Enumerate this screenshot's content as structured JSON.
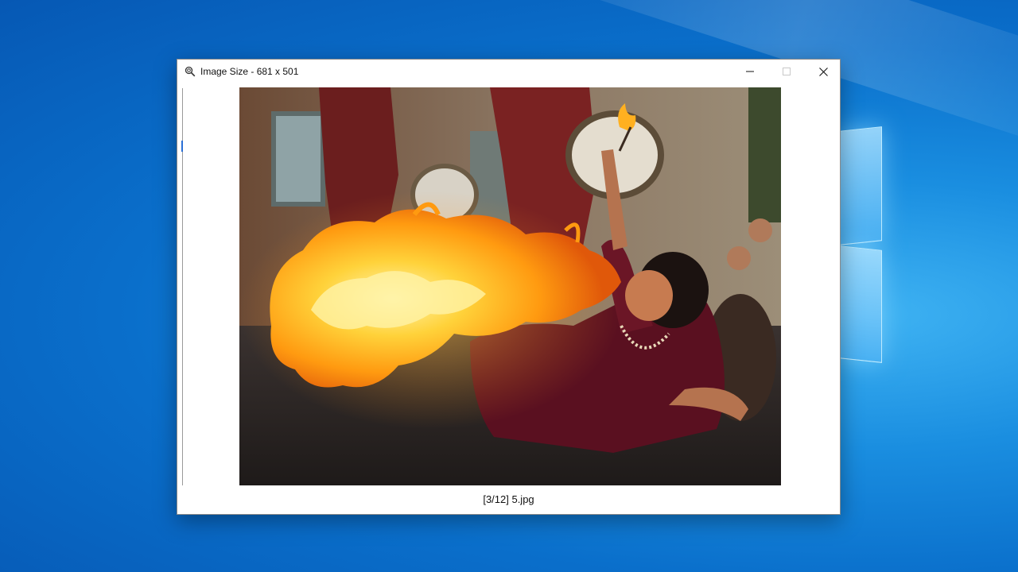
{
  "window": {
    "title": "Image Size - 681 x 501",
    "app_icon": "magnifier-icon",
    "controls": {
      "minimize": "minimize-icon",
      "maximize": "maximize-icon",
      "close": "close-icon"
    }
  },
  "viewer": {
    "caption": "[3/12] 5.jpg"
  },
  "colors": {
    "desktop_blue": "#0a6fcb",
    "window_bg": "#ffffff",
    "caret": "#2a6fd6"
  }
}
